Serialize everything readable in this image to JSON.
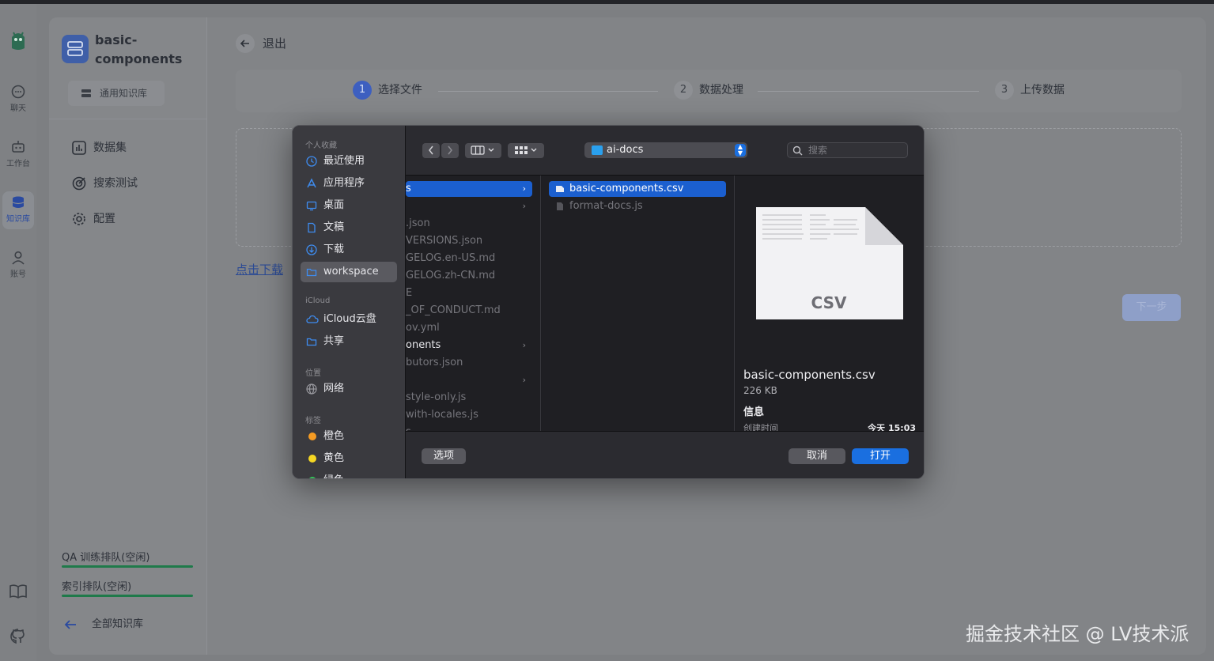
{
  "rail": {
    "items": [
      {
        "label": "聊天"
      },
      {
        "label": "工作台"
      },
      {
        "label": "知识库"
      },
      {
        "label": "账号"
      }
    ]
  },
  "sidebar": {
    "kb_title": "basic-components",
    "kb_type": "通用知识库",
    "nav": [
      {
        "label": "数据集"
      },
      {
        "label": "搜索测试"
      },
      {
        "label": "配置"
      }
    ],
    "queues": [
      {
        "label": "QA 训练排队(空闲)"
      },
      {
        "label": "索引排队(空闲)"
      }
    ],
    "back_all": "全部知识库"
  },
  "main": {
    "exit": "退出",
    "steps": [
      {
        "num": "1",
        "label": "选择文件"
      },
      {
        "num": "2",
        "label": "数据处理"
      },
      {
        "num": "3",
        "label": "上传数据"
      }
    ],
    "download_link": "点击下载",
    "next_button": "下一步"
  },
  "dialog": {
    "sidebar": {
      "sections": [
        {
          "title": "个人收藏",
          "items": [
            "最近使用",
            "应用程序",
            "桌面",
            "文稿",
            "下载",
            "workspace"
          ]
        },
        {
          "title": "iCloud",
          "items": [
            "iCloud云盘",
            "共享"
          ]
        },
        {
          "title": "位置",
          "items": [
            "网络"
          ]
        },
        {
          "title": "标签",
          "items": [
            "橙色",
            "黄色",
            "绿色"
          ]
        }
      ],
      "selected": "workspace",
      "tag_colors": [
        "#f59b23",
        "#f5d723",
        "#34c759"
      ]
    },
    "toolbar": {
      "path": "ai-docs",
      "search_placeholder": "搜索"
    },
    "column1": [
      {
        "text": "s",
        "selected": true,
        "chevron": true
      },
      {
        "text": "",
        "chevron": true
      },
      {
        "text": ".json"
      },
      {
        "text": "VERSIONS.json"
      },
      {
        "text": "GELOG.en-US.md"
      },
      {
        "text": "GELOG.zh-CN.md"
      },
      {
        "text": "E"
      },
      {
        "text": "_OF_CONDUCT.md"
      },
      {
        "text": "ov.yml"
      },
      {
        "text": "onents",
        "bold": true,
        "chevron": true
      },
      {
        "text": "butors.json"
      },
      {
        "text": "",
        "chevron": true
      },
      {
        "text": "style-only.js"
      },
      {
        "text": "with-locales.js"
      },
      {
        "text": "s"
      }
    ],
    "column2": [
      {
        "text": "basic-components.csv",
        "selected": true
      },
      {
        "text": "format-docs.js"
      }
    ],
    "preview": {
      "ext": "CSV",
      "name": "basic-components.csv",
      "size": "226 KB",
      "info": "信息",
      "created_label": "创建时间",
      "created_value": "今天 15:03"
    },
    "footer": {
      "options": "选项",
      "cancel": "取消",
      "open": "打开"
    }
  },
  "watermark": "掘金技术社区 @ LV技术派"
}
